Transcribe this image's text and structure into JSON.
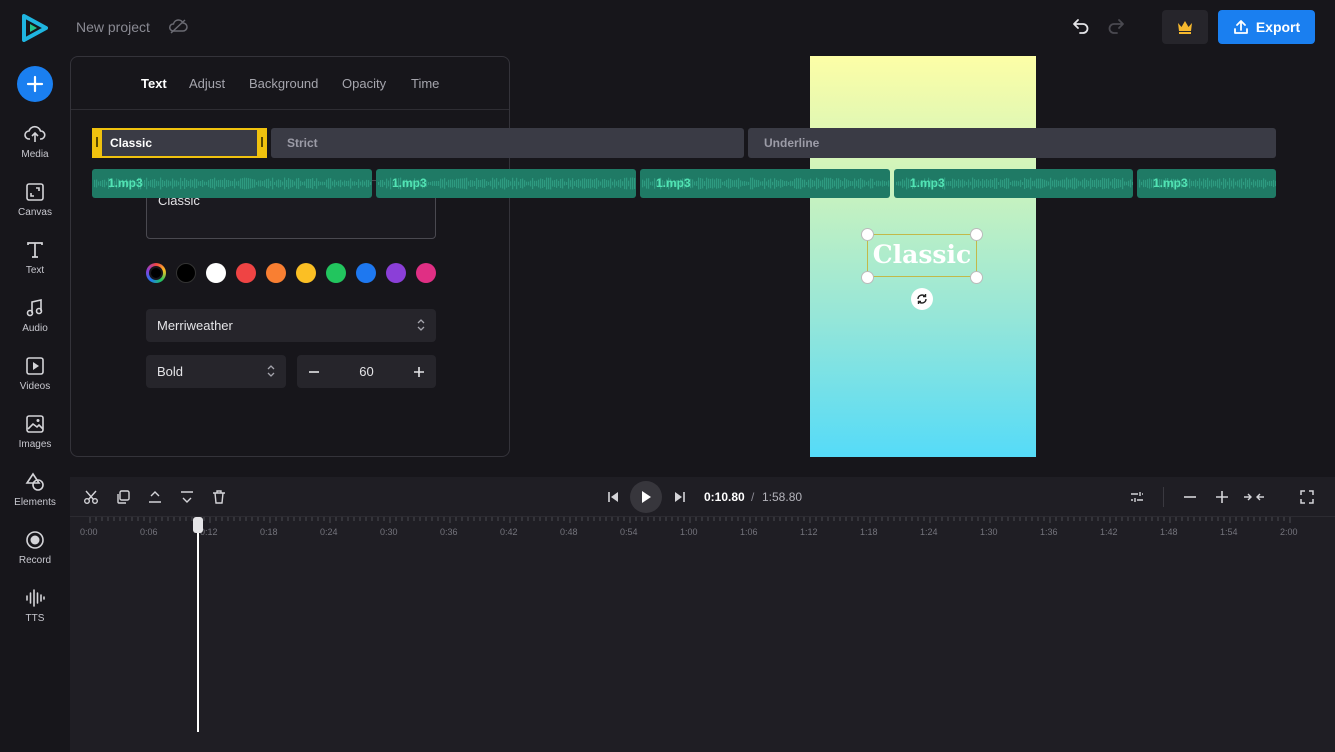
{
  "header": {
    "project_title": "New project",
    "export_label": "Export"
  },
  "sidebar": {
    "items": [
      {
        "label": "Media",
        "icon": "upload-cloud-icon"
      },
      {
        "label": "Canvas",
        "icon": "canvas-resize-icon"
      },
      {
        "label": "Text",
        "icon": "text-icon"
      },
      {
        "label": "Audio",
        "icon": "music-note-icon"
      },
      {
        "label": "Videos",
        "icon": "video-play-icon"
      },
      {
        "label": "Images",
        "icon": "image-icon"
      },
      {
        "label": "Elements",
        "icon": "shapes-icon"
      },
      {
        "label": "Record",
        "icon": "record-icon"
      },
      {
        "label": "TTS",
        "icon": "waveform-icon"
      }
    ]
  },
  "panel": {
    "tabs": [
      "Text",
      "Adjust",
      "Background",
      "Opacity",
      "Time"
    ],
    "active_tab": "Text",
    "text_value": "Classic",
    "swatches": [
      "#000000",
      "#ffffff",
      "#ef4444",
      "#f97f32",
      "#fbbf24",
      "#22c55e",
      "#1e78f0",
      "#8b3fd8",
      "#e02f84"
    ],
    "font": "Merriweather",
    "weight": "Bold",
    "size": "60"
  },
  "preview": {
    "text": "Classic"
  },
  "timeline": {
    "current_time": "0:10.80",
    "separator": "/",
    "total_time": "1:58.80",
    "ticks": [
      "0:00",
      "0:06",
      "0:12",
      "0:18",
      "0:24",
      "0:30",
      "0:36",
      "0:42",
      "0:48",
      "0:54",
      "1:00",
      "1:06",
      "1:12",
      "1:18",
      "1:24",
      "1:30",
      "1:36",
      "1:42",
      "1:48",
      "1:54",
      "2:00"
    ],
    "text_clips": [
      "Classic",
      "Strict",
      "Underline"
    ],
    "audio_clips": [
      "1.mp3",
      "1.mp3",
      "1.mp3",
      "1.mp3",
      "1.mp3"
    ]
  },
  "colors": {
    "accent": "#1a7ff0",
    "selection": "#f0c20e",
    "audio_clip": "#1f7a65"
  }
}
